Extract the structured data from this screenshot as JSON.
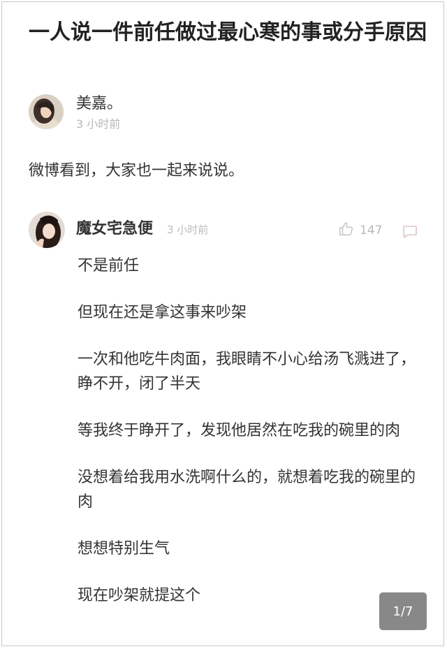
{
  "post": {
    "title": "一人说一件前任做过最心寒的事或分手原因",
    "author": {
      "name": "美嘉。",
      "time": "3 小时前"
    },
    "body": "微博看到，大家也一起来说说。"
  },
  "comment": {
    "author": {
      "name": "魔女宅急便",
      "time": "3 小时前"
    },
    "likes": "147",
    "paragraphs": [
      "不是前任",
      "但现在还是拿这事来吵架",
      "一次和他吃牛肉面，我眼睛不小心给汤飞溅进了，睁不开，闭了半天",
      "等我终于睁开了，发现他居然在吃我的碗里的肉",
      "没想着给我用水洗啊什么的，就想着吃我的碗里的肉",
      "想想特别生气",
      "现在吵架就提这个"
    ]
  },
  "pager": {
    "label": "1/7"
  },
  "icons": {
    "like": "thumbs-up-icon",
    "reply": "comment-bubble-icon"
  },
  "colors": {
    "text": "#333333",
    "muted": "#b8b8b8",
    "badge": "#6e6e6e"
  }
}
